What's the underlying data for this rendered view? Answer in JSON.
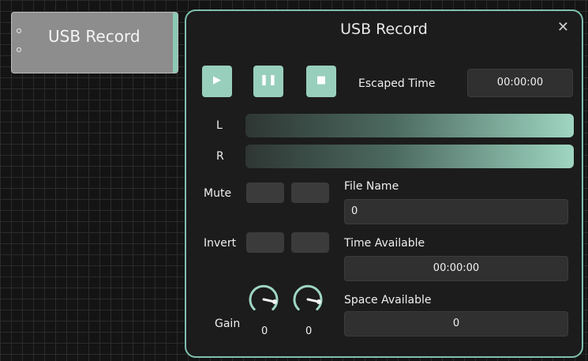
{
  "node": {
    "title": "USB Record"
  },
  "dialog": {
    "title": "USB Record",
    "close_icon": "close-icon",
    "transport": {
      "play_icon": "play-icon",
      "pause_icon": "pause-icon",
      "stop_icon": "stop-icon"
    },
    "escaped_time_label": "Escaped Time",
    "escaped_time_value": "00:00:00",
    "meters": {
      "left_label": "L",
      "right_label": "R"
    },
    "mute_label": "Mute",
    "invert_label": "Invert",
    "gain_label": "Gain",
    "gain_values": [
      "0",
      "0"
    ],
    "file_name_label": "File Name",
    "file_name_value": "0",
    "time_available_label": "Time Available",
    "time_available_value": "00:00:00",
    "space_available_label": "Space Available",
    "space_available_value": "0"
  },
  "colors": {
    "accent": "#98cfbc",
    "border": "#7fbfae",
    "panel": "#1c1c1c",
    "field": "#303030"
  }
}
